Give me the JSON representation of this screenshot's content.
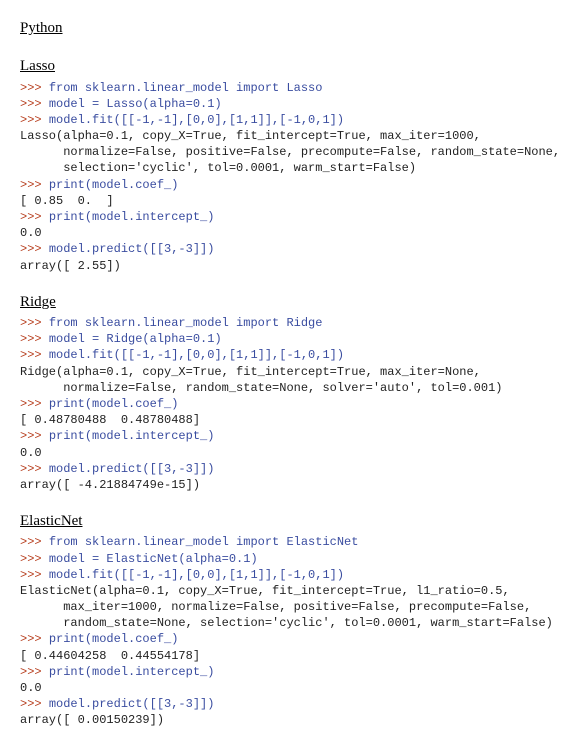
{
  "page": {
    "title": "Python"
  },
  "sections": [
    {
      "title": "Lasso",
      "lines": [
        {
          "type": "in",
          "text": "from sklearn.linear_model import Lasso"
        },
        {
          "type": "in",
          "text": "model = Lasso(alpha=0.1)"
        },
        {
          "type": "in",
          "text": "model.fit([[-1,-1],[0,0],[1,1]],[-1,0,1])"
        },
        {
          "type": "out",
          "text": "Lasso(alpha=0.1, copy_X=True, fit_intercept=True, max_iter=1000,"
        },
        {
          "type": "out",
          "text": "      normalize=False, positive=False, precompute=False, random_state=None,"
        },
        {
          "type": "out",
          "text": "      selection='cyclic', tol=0.0001, warm_start=False)"
        },
        {
          "type": "in",
          "text": "print(model.coef_)"
        },
        {
          "type": "out",
          "text": "[ 0.85  0.  ]"
        },
        {
          "type": "in",
          "text": "print(model.intercept_)"
        },
        {
          "type": "out",
          "text": "0.0"
        },
        {
          "type": "in",
          "text": "model.predict([[3,-3]])"
        },
        {
          "type": "out",
          "text": "array([ 2.55])"
        }
      ]
    },
    {
      "title": "Ridge",
      "lines": [
        {
          "type": "in",
          "text": "from sklearn.linear_model import Ridge"
        },
        {
          "type": "in",
          "text": "model = Ridge(alpha=0.1)"
        },
        {
          "type": "in",
          "text": "model.fit([[-1,-1],[0,0],[1,1]],[-1,0,1])"
        },
        {
          "type": "out",
          "text": "Ridge(alpha=0.1, copy_X=True, fit_intercept=True, max_iter=None,"
        },
        {
          "type": "out",
          "text": "      normalize=False, random_state=None, solver='auto', tol=0.001)"
        },
        {
          "type": "in",
          "text": "print(model.coef_)"
        },
        {
          "type": "out",
          "text": "[ 0.48780488  0.48780488]"
        },
        {
          "type": "in",
          "text": "print(model.intercept_)"
        },
        {
          "type": "out",
          "text": "0.0"
        },
        {
          "type": "in",
          "text": "model.predict([[3,-3]])"
        },
        {
          "type": "out",
          "text": "array([ -4.21884749e-15])"
        }
      ]
    },
    {
      "title": "ElasticNet",
      "lines": [
        {
          "type": "in",
          "text": "from sklearn.linear_model import ElasticNet"
        },
        {
          "type": "in",
          "text": "model = ElasticNet(alpha=0.1)"
        },
        {
          "type": "in",
          "text": "model.fit([[-1,-1],[0,0],[1,1]],[-1,0,1])"
        },
        {
          "type": "out",
          "text": "ElasticNet(alpha=0.1, copy_X=True, fit_intercept=True, l1_ratio=0.5,"
        },
        {
          "type": "out",
          "text": "      max_iter=1000, normalize=False, positive=False, precompute=False,"
        },
        {
          "type": "out",
          "text": "      random_state=None, selection='cyclic', tol=0.0001, warm_start=False)"
        },
        {
          "type": "in",
          "text": "print(model.coef_)"
        },
        {
          "type": "out",
          "text": "[ 0.44604258  0.44554178]"
        },
        {
          "type": "in",
          "text": "print(model.intercept_)"
        },
        {
          "type": "out",
          "text": "0.0"
        },
        {
          "type": "in",
          "text": "model.predict([[3,-3]])"
        },
        {
          "type": "out",
          "text": "array([ 0.00150239])"
        }
      ]
    }
  ],
  "prompt": ">>> "
}
